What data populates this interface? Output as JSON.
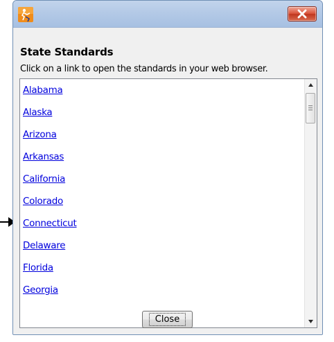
{
  "dialog": {
    "heading": "State Standards",
    "instruction": "Click on a link to open the standards in your web browser.",
    "close_label": "Close",
    "close_icon": "close-x-icon"
  },
  "states": [
    "Alabama",
    "Alaska",
    "Arizona",
    "Arkansas",
    "California",
    "Colorado",
    "Connecticut",
    "Delaware",
    "Florida",
    "Georgia"
  ],
  "colors": {
    "link": "#0000dd",
    "title_bar": "#b3c9e6",
    "close_button": "#c0361e"
  }
}
